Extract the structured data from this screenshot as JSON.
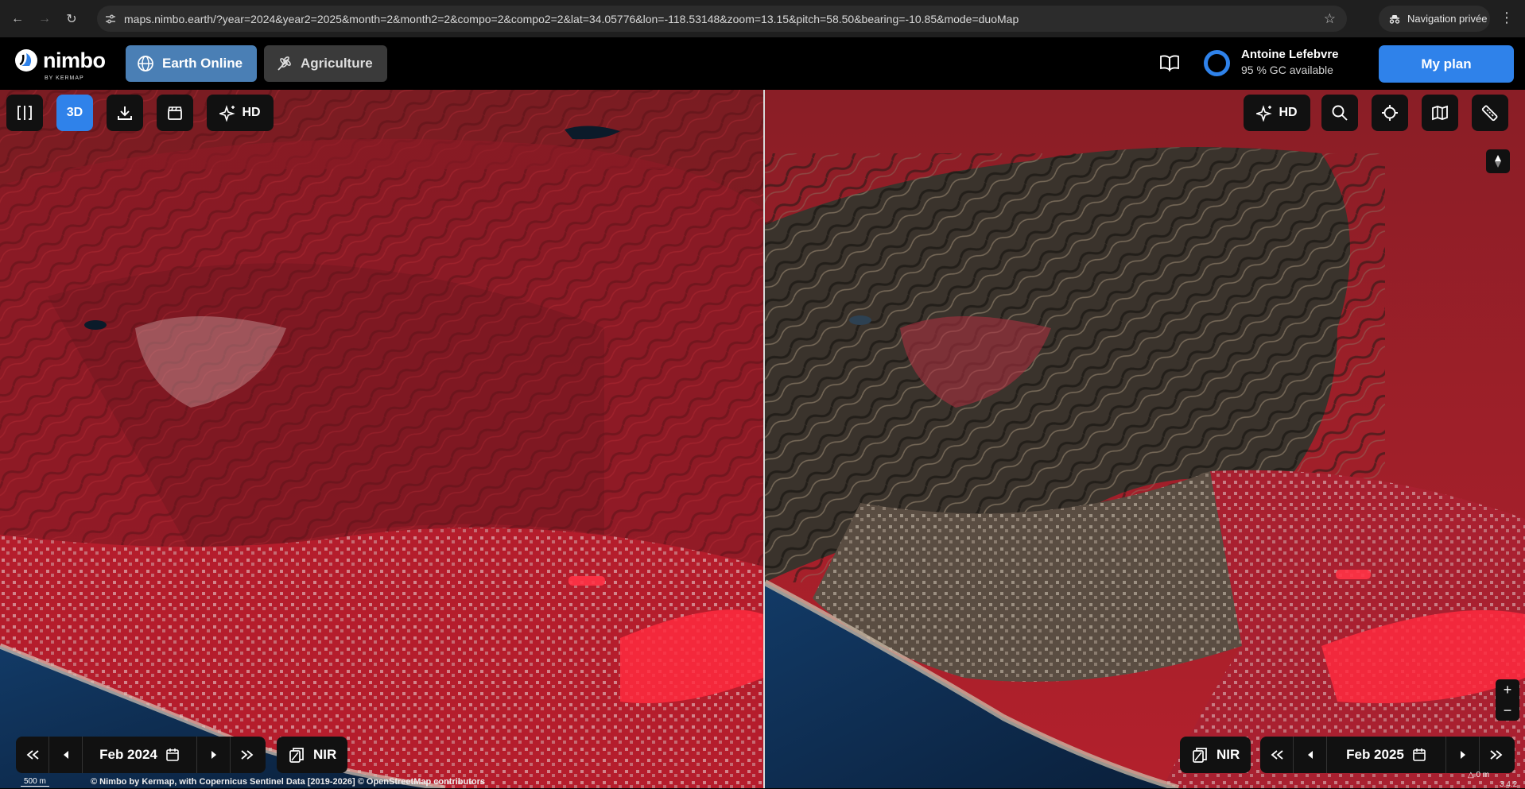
{
  "browser": {
    "url": "maps.nimbo.earth/?year=2024&year2=2025&month=2&month2=2&compo=2&compo2=2&lat=34.05776&lon=-118.53148&zoom=13.15&pitch=58.50&bearing=-10.85&mode=duoMap",
    "private_label": "Navigation privée"
  },
  "header": {
    "logo_word": "nimbo",
    "logo_by": "BY KERMAP",
    "modes": [
      {
        "label": "Earth Online",
        "active": true
      },
      {
        "label": "Agriculture",
        "active": false
      }
    ],
    "user_name": "Antoine Lefebvre",
    "gc_available": "95 % GC available",
    "plan_button": "My plan"
  },
  "left_map": {
    "toolbar": {
      "split_icon": "split-view-icon",
      "mode_3d": "3D",
      "download_icon": "download-icon",
      "clapper_icon": "clapperboard-icon",
      "hd_label": "HD"
    },
    "date": "Feb 2024",
    "composite": "NIR"
  },
  "right_map": {
    "toolbar": {
      "hd_label": "HD",
      "search_icon": "search-icon",
      "locate_icon": "crosshair-icon",
      "layers_icon": "map-icon",
      "ruler_icon": "ruler-icon"
    },
    "date": "Feb 2025",
    "composite": "NIR"
  },
  "footer": {
    "scale": "500 m",
    "attribution": "© Nimbo by Kermap, with Copernicus Sentinel Data [2019-2026] © OpenStreetMap contributors",
    "elevation": "0 m",
    "zoom_readout": "3.4.2"
  },
  "colors": {
    "accent": "#2f82ea",
    "vegetation_red": "#c21a2a",
    "burn_scar": "#3a332c",
    "ocean": "#0d2a4e"
  }
}
